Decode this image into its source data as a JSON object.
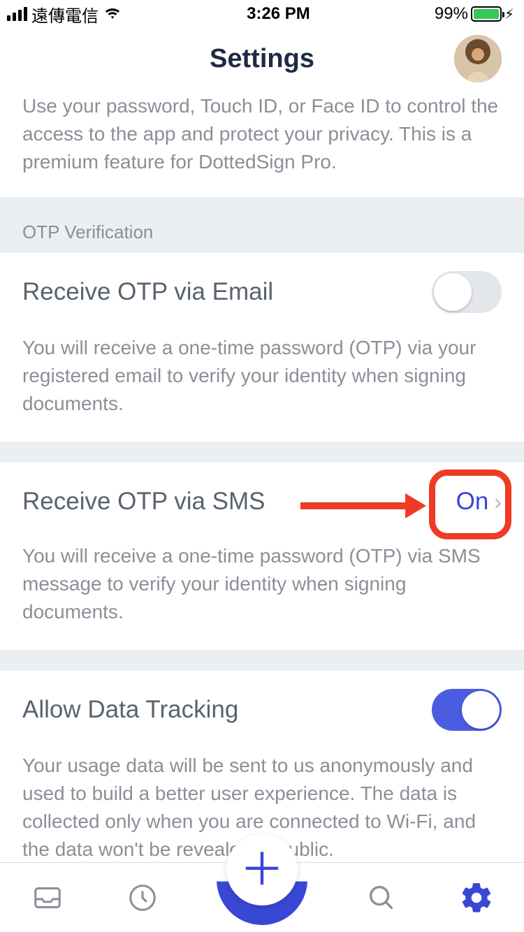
{
  "status": {
    "carrier": "遠傳電信",
    "time": "3:26 PM",
    "battery_pct": "99%"
  },
  "header": {
    "title": "Settings"
  },
  "sections": {
    "lock_desc": "Use your password, Touch ID, or Face ID to control the access to the app and protect your privacy. This is a premium feature for DottedSign Pro.",
    "otp_header": "OTP Verification",
    "otp_email": {
      "title": "Receive OTP via Email",
      "desc": "You will receive a one-time password (OTP) via your registered email to verify your identity when signing documents.",
      "state": "off"
    },
    "otp_sms": {
      "title": "Receive OTP via SMS",
      "value": "On",
      "desc": "You will receive a one-time password (OTP) via SMS message to verify your identity when signing documents."
    },
    "tracking": {
      "title": "Allow Data Tracking",
      "desc": "Your usage data will be sent to us anonymously and used to build a better user experience. The data is collected only when you are connected to Wi-Fi, and the data won't be revealed in public.",
      "state": "on"
    }
  }
}
